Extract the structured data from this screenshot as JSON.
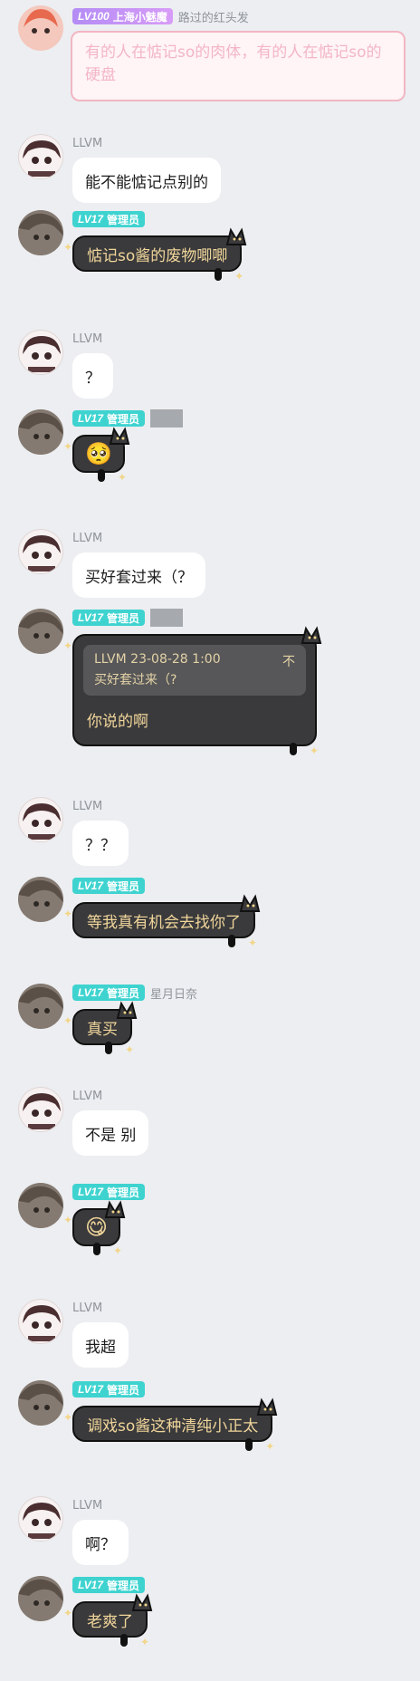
{
  "top_message": {
    "level": "LV100",
    "badge_title": "上海小魅魔",
    "username": "路过的红头发",
    "text": "有的人在惦记so的肉体，有的人在惦记so的硬盘"
  },
  "messages": [
    {
      "sender": "LLVM",
      "text": "能不能惦记点别的"
    },
    {
      "sender": "admin",
      "level": "LV17",
      "badge_title": "管理员",
      "text": "惦记so酱的废物唧唧"
    },
    {
      "sender": "LLVM",
      "text": "？"
    },
    {
      "sender": "admin",
      "level": "LV17",
      "badge_title": "管理员",
      "emoji": "🥺"
    },
    {
      "sender": "LLVM",
      "text": "买好套过来（？"
    },
    {
      "sender": "admin",
      "level": "LV17",
      "badge_title": "管理员",
      "quote": {
        "author": "LLVM",
        "time": "23-08-28 1:00",
        "text": "买好套过来（?",
        "collapse": "不"
      },
      "text": "你说的啊"
    },
    {
      "sender": "LLVM",
      "text": "？？"
    },
    {
      "sender": "admin",
      "level": "LV17",
      "badge_title": "管理员",
      "text": "等我真有机会去找你了"
    },
    {
      "sender": "admin",
      "level": "LV17",
      "badge_title": "管理员",
      "username": "星月日奈",
      "text": "真买"
    },
    {
      "sender": "LLVM",
      "text": "不是 别"
    },
    {
      "sender": "admin",
      "level": "LV17",
      "badge_title": "管理员",
      "emoji": "😋"
    },
    {
      "sender": "LLVM",
      "text": "我超"
    },
    {
      "sender": "admin",
      "level": "LV17",
      "badge_title": "管理员",
      "text": "调戏so酱这种清纯小正太"
    },
    {
      "sender": "LLVM",
      "text": "啊？"
    },
    {
      "sender": "admin",
      "level": "LV17",
      "badge_title": "管理员",
      "text": "老爽了"
    }
  ],
  "llvm_name": "LLVM"
}
